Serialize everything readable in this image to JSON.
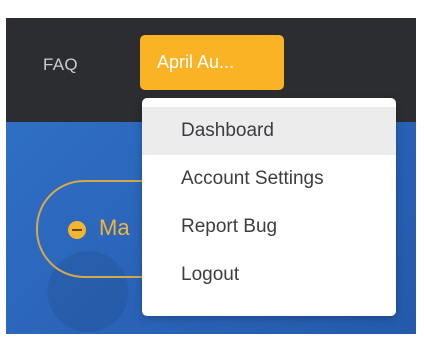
{
  "nav": {
    "faq_label": "FAQ",
    "user_button_label": "April Au..."
  },
  "hero": {
    "pill_text": "Ma"
  },
  "dropdown": {
    "items": [
      {
        "label": "Dashboard"
      },
      {
        "label": "Account Settings"
      },
      {
        "label": "Report Bug"
      },
      {
        "label": "Logout"
      }
    ]
  },
  "colors": {
    "topbar": "#2b2d31",
    "accent": "#f9b325",
    "hero_blue": "#2a64b9"
  }
}
